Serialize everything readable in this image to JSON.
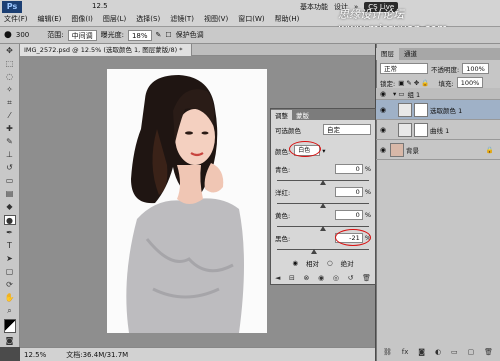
{
  "app_logo": "Ps",
  "zoom_menu": "12.5",
  "title_right": {
    "basic": "基本功能",
    "design": "设计",
    "more": "»",
    "cs_live": "CS Live"
  },
  "watermark": "思缘设计论坛 www.missyuan.com",
  "menu": [
    "文件(F)",
    "编辑(E)",
    "图像(I)",
    "图层(L)",
    "选择(S)",
    "滤镜(T)",
    "视图(V)",
    "窗口(W)",
    "帮助(H)"
  ],
  "options": {
    "size": "300",
    "range_label": "范围:",
    "range_value": "中间调",
    "exposure_label": "曝光度:",
    "exposure_value": "18%",
    "protect_label": "保护色调"
  },
  "document_tab": "IMG_2572.psd @ 12.5% (选取颜色 1, 图层蒙版/8) *",
  "status": {
    "zoom": "12.5%",
    "doc": "文档:36.4M/31.7M"
  },
  "adjustments": {
    "tabs": [
      "调整",
      "蒙版"
    ],
    "preset": "自定",
    "preset_label": "可选颜色",
    "color_label": "颜色:",
    "color_value": "白色",
    "sliders": [
      {
        "label": "青色:",
        "value": "0",
        "unit": "%"
      },
      {
        "label": "洋红:",
        "value": "0",
        "unit": "%"
      },
      {
        "label": "黄色:",
        "value": "0",
        "unit": "%"
      },
      {
        "label": "黑色:",
        "value": "-21",
        "unit": "%"
      }
    ],
    "mode_relative": "相对",
    "mode_absolute": "绝对"
  },
  "layers": {
    "tabs": [
      "图层",
      "通道"
    ],
    "blend_mode": "正常",
    "opacity_label": "不透明度:",
    "opacity_value": "100%",
    "lock_label": "锁定:",
    "fill_label": "填充:",
    "fill_value": "100%",
    "group": "组 1",
    "items": [
      "选取颜色 1",
      "曲线 1",
      "背景"
    ]
  }
}
